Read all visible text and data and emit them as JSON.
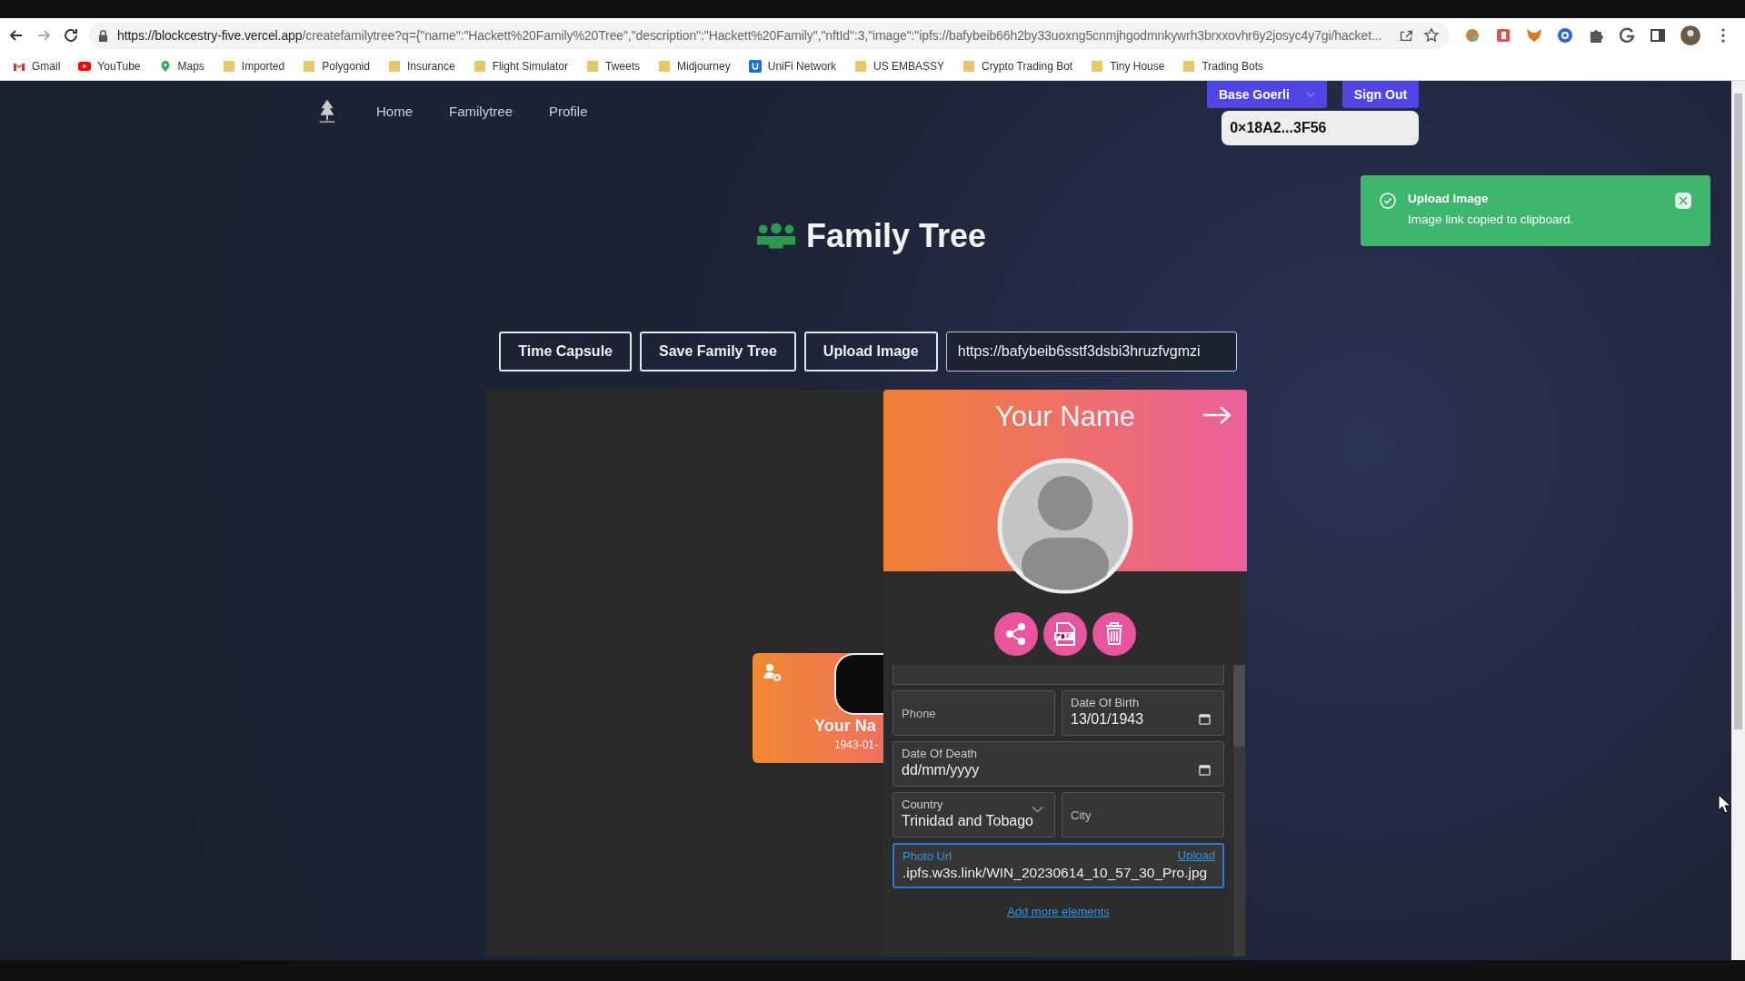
{
  "browser": {
    "url_host": "https://blockcestry-five.vercel.app",
    "url_rest": "/createfamilytree?q={\"name\":\"Hackett%20Family%20Tree\",\"description\":\"Hackett%20Family\",\"nftId\":3,\"image\":\"ipfs://bafybeib66h2by33uoxng5cnmjhgodmnkywrh3brxxovhr6y2josyc4y7gi/hacket...",
    "bookmarks": [
      {
        "label": "Gmail",
        "kind": "gmail"
      },
      {
        "label": "YouTube",
        "kind": "youtube"
      },
      {
        "label": "Maps",
        "kind": "maps"
      },
      {
        "label": "Imported",
        "kind": "folder"
      },
      {
        "label": "Polygonid",
        "kind": "folder"
      },
      {
        "label": "Insurance",
        "kind": "folder"
      },
      {
        "label": "Flight Simulator",
        "kind": "folder"
      },
      {
        "label": "Tweets",
        "kind": "folder"
      },
      {
        "label": "Midjourney",
        "kind": "folder"
      },
      {
        "label": "UniFi Network",
        "kind": "unifi"
      },
      {
        "label": "US EMBASSY",
        "kind": "folder"
      },
      {
        "label": "Crypto Trading Bot",
        "kind": "folder"
      },
      {
        "label": "Tiny House",
        "kind": "folder"
      },
      {
        "label": "Trading Bots",
        "kind": "folder"
      }
    ]
  },
  "nav": {
    "links": [
      "Home",
      "Familytree",
      "Profile"
    ],
    "network": "Base Goerli",
    "sign_out": "Sign Out",
    "address": "0×18A2...3F56"
  },
  "toast": {
    "title": "Upload Image",
    "message": "Image link copied to clipboard."
  },
  "title": "Family Tree",
  "actions": [
    "Time Capsule",
    "Save Family Tree",
    "Upload Image"
  ],
  "link_field": {
    "value": "https://bafybeib6sstf3dsbi3hruzfvgmzi"
  },
  "node": {
    "name": "Your Na",
    "date": "1943-01-"
  },
  "card": {
    "name": "Your Name",
    "fields": [
      {
        "label": "Phone",
        "kind": "text"
      },
      {
        "label": "Date Of Birth",
        "value": "13/01/1943",
        "kind": "date"
      },
      {
        "label": "Date Of Death",
        "value": "dd/mm/yyyy",
        "kind": "date"
      },
      {
        "label": "Country",
        "value": "Trinidad and Tobago",
        "kind": "select"
      },
      {
        "label": "City",
        "kind": "text"
      },
      {
        "label": "Photo Url",
        "value": ".ipfs.w3s.link/WIN_20230614_10_57_30_Pro.jpg",
        "kind": "url",
        "action": "Upload"
      }
    ],
    "add_more": "Add more elements"
  }
}
